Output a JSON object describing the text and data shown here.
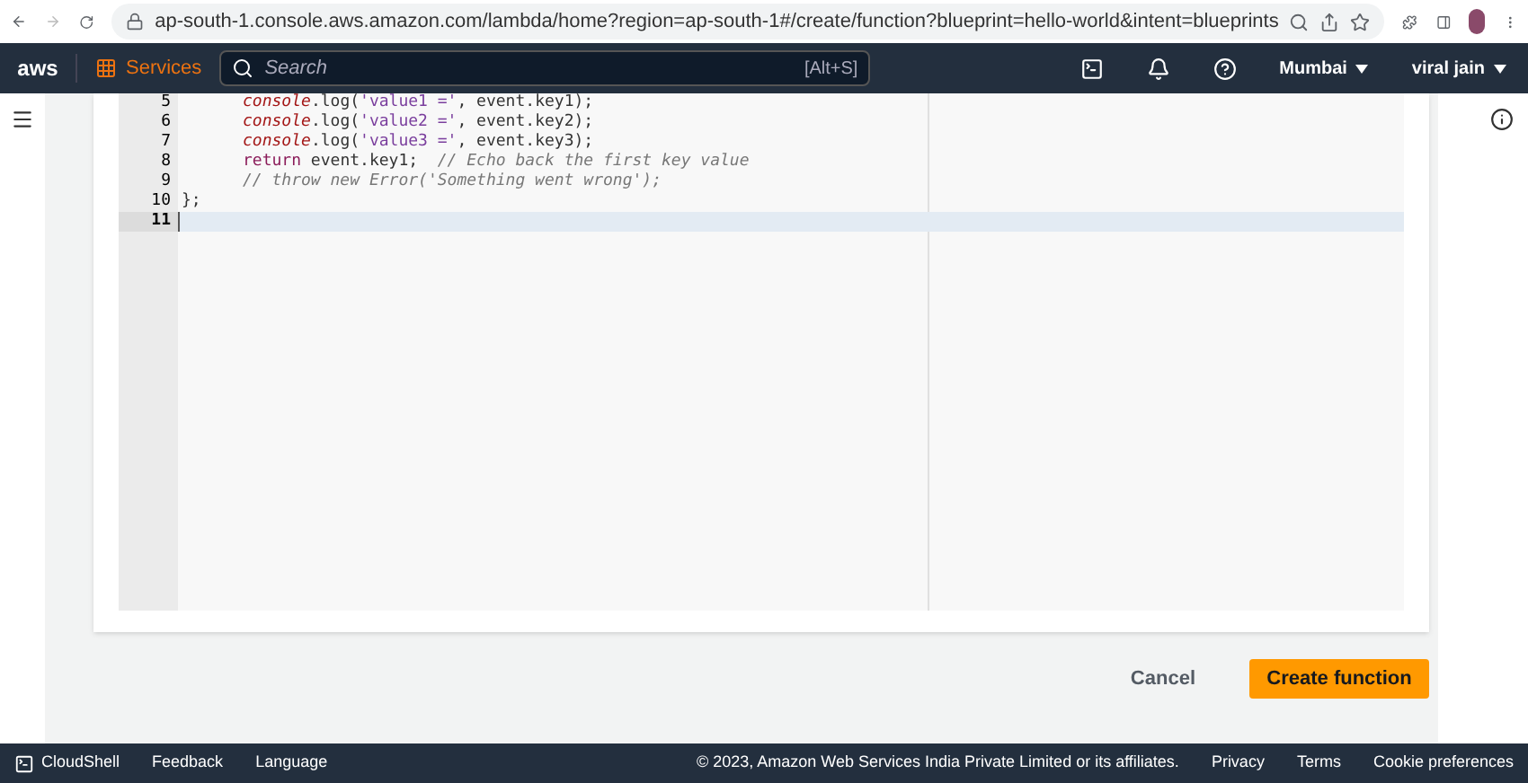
{
  "browser": {
    "url": "ap-south-1.console.aws.amazon.com/lambda/home?region=ap-south-1#/create/function?blueprint=hello-world&intent=blueprints"
  },
  "nav": {
    "logo": "aws",
    "services": "Services",
    "search": {
      "placeholder": "Search"
    },
    "shortcut": "[Alt+S]",
    "region": "Mumbai",
    "user": "viral jain"
  },
  "editor": {
    "lines": [
      {
        "number": "5",
        "active": false,
        "tokens": [
          {
            "kind": "object",
            "text": "console"
          },
          {
            "kind": "plain",
            "text": ".log("
          },
          {
            "kind": "string",
            "text": "'value1 ='"
          },
          {
            "kind": "plain",
            "text": ", event.key1);"
          }
        ]
      },
      {
        "number": "6",
        "active": false,
        "tokens": [
          {
            "kind": "object",
            "text": "console"
          },
          {
            "kind": "plain",
            "text": ".log("
          },
          {
            "kind": "string",
            "text": "'value2 ='"
          },
          {
            "kind": "plain",
            "text": ", event.key2);"
          }
        ]
      },
      {
        "number": "7",
        "active": false,
        "tokens": [
          {
            "kind": "object",
            "text": "console"
          },
          {
            "kind": "plain",
            "text": ".log("
          },
          {
            "kind": "string",
            "text": "'value3 ='"
          },
          {
            "kind": "plain",
            "text": ", event.key3);"
          }
        ]
      },
      {
        "number": "8",
        "active": false,
        "tokens": [
          {
            "kind": "keyword",
            "text": "return"
          },
          {
            "kind": "plain",
            "text": " event.key1;  "
          },
          {
            "kind": "comment",
            "text": "// Echo back the first key value"
          }
        ]
      },
      {
        "number": "9",
        "active": false,
        "tokens": [
          {
            "kind": "comment",
            "text": "// throw new Error('Something went wrong');"
          }
        ]
      },
      {
        "number": "10",
        "active": false,
        "tokens": [
          {
            "kind": "plain",
            "text": "};"
          }
        ]
      },
      {
        "number": "11",
        "active": true
      }
    ]
  },
  "actions": {
    "cancel": "Cancel",
    "create": "Create function"
  },
  "footer": {
    "links": [
      "CloudShell",
      "Feedback",
      "Language"
    ],
    "copyright": "© 2023, Amazon Web Services India Private Limited or its affiliates.",
    "legal": [
      "Privacy",
      "Terms",
      "Cookie preferences"
    ]
  }
}
